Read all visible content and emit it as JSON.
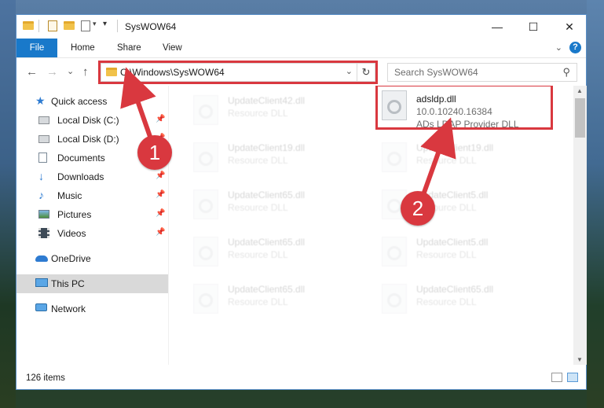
{
  "window": {
    "title": "SysWOW64",
    "minimize_glyph": "—",
    "maximize_glyph": "☐",
    "close_glyph": "✕"
  },
  "ribbon": {
    "file_label": "File",
    "tabs": [
      "Home",
      "Share",
      "View"
    ],
    "expand_glyph": "⌄",
    "help_glyph": "?"
  },
  "navigation": {
    "back_glyph": "←",
    "forward_glyph": "→",
    "recent_glyph": "⌄",
    "up_glyph": "↑",
    "address": "C:\\Windows\\SysWOW64",
    "dropdown_glyph": "⌄",
    "refresh_glyph": "↻",
    "search_placeholder": "Search SysWOW64",
    "search_glyph": "⚲"
  },
  "sidebar": {
    "items": [
      {
        "label": "Quick access",
        "icon": "star-icon"
      },
      {
        "label": "Local Disk (C:)",
        "icon": "drive-icon",
        "pinned": true
      },
      {
        "label": "Local Disk (D:)",
        "icon": "drive-icon",
        "pinned": true
      },
      {
        "label": "Documents",
        "icon": "documents-icon",
        "pinned": true
      },
      {
        "label": "Downloads",
        "icon": "downloads-icon",
        "pinned": true
      },
      {
        "label": "Music",
        "icon": "music-icon",
        "pinned": true
      },
      {
        "label": "Pictures",
        "icon": "pictures-icon",
        "pinned": true
      },
      {
        "label": "Videos",
        "icon": "videos-icon",
        "pinned": true
      },
      {
        "label": "OneDrive",
        "icon": "onedrive-icon"
      },
      {
        "label": "This PC",
        "icon": "pc-icon",
        "selected": true
      },
      {
        "label": "Network",
        "icon": "network-icon"
      }
    ],
    "pin_glyph": "📌"
  },
  "files": [
    {
      "name": "UpdateClient42.dll",
      "type": "Resource DLL",
      "faded": true
    },
    {
      "name": "adsldp.dll",
      "version": "10.0.10240.16384",
      "type": "ADs LDAP Provider DLL",
      "faded": false
    },
    {
      "name": "UpdateClient19.dll",
      "type": "Resource DLL",
      "faded": true
    },
    {
      "name": "UpdateClient19.dll",
      "type": "Resource DLL",
      "faded": true
    },
    {
      "name": "UpdateClient65.dll",
      "type": "Resource DLL",
      "faded": true
    },
    {
      "name": "UpdateClient5.dll",
      "type": "Resource DLL",
      "faded": true
    },
    {
      "name": "UpdateClient65.dll",
      "type": "Resource DLL",
      "faded": true
    },
    {
      "name": "UpdateClient5.dll",
      "type": "Resource DLL",
      "faded": true
    },
    {
      "name": "UpdateClient65.dll",
      "type": "Resource DLL",
      "faded": true
    },
    {
      "name": "UpdateClient65.dll",
      "type": "Resource DLL",
      "faded": true
    }
  ],
  "status": {
    "item_count": "126 items"
  },
  "annotations": {
    "step1": "1",
    "step2": "2",
    "highlight_color": "#d9383f"
  },
  "colors": {
    "accent": "#1979ca",
    "selected_bg": "#d9d9d9"
  }
}
